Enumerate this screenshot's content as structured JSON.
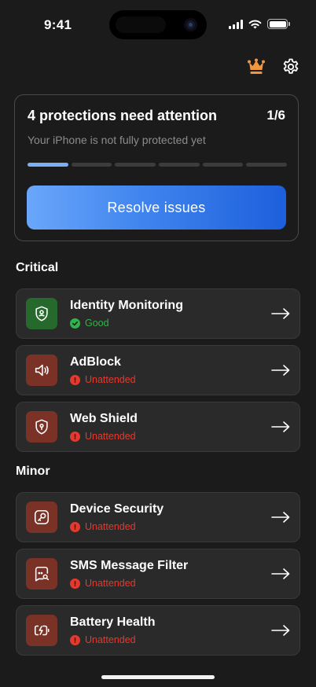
{
  "status_bar": {
    "time": "9:41"
  },
  "header": {
    "crown_icon": "crown-icon",
    "settings_icon": "gear-icon",
    "accent": "#f0963c"
  },
  "summary": {
    "title": "4 protections need attention",
    "step": "1/6",
    "subtitle": "Your iPhone is not fully protected yet",
    "progress_total": 6,
    "progress_done": 1,
    "button_label": "Resolve  issues"
  },
  "sections": {
    "critical": {
      "title": "Critical"
    },
    "minor": {
      "title": "Minor"
    }
  },
  "items": [
    {
      "title": "Identity Monitoring",
      "status": "Good",
      "state": "good",
      "icon": "shield-user-icon"
    },
    {
      "title": "AdBlock",
      "status": "Unattended",
      "state": "bad",
      "icon": "speaker-icon"
    },
    {
      "title": "Web Shield",
      "status": "Unattended",
      "state": "bad",
      "icon": "shield-pin-icon"
    },
    {
      "title": "Device Security",
      "status": "Unattended",
      "state": "bad",
      "icon": "key-icon"
    },
    {
      "title": "SMS Message Filter",
      "status": "Unattended",
      "state": "bad",
      "icon": "message-search-icon"
    },
    {
      "title": "Battery Health",
      "status": "Unattended",
      "state": "bad",
      "icon": "battery-charge-icon"
    }
  ],
  "colors": {
    "good": "#2fb34a",
    "bad": "#e5392c",
    "button_start": "#6aa7fb",
    "button_end": "#1d5fdc"
  }
}
